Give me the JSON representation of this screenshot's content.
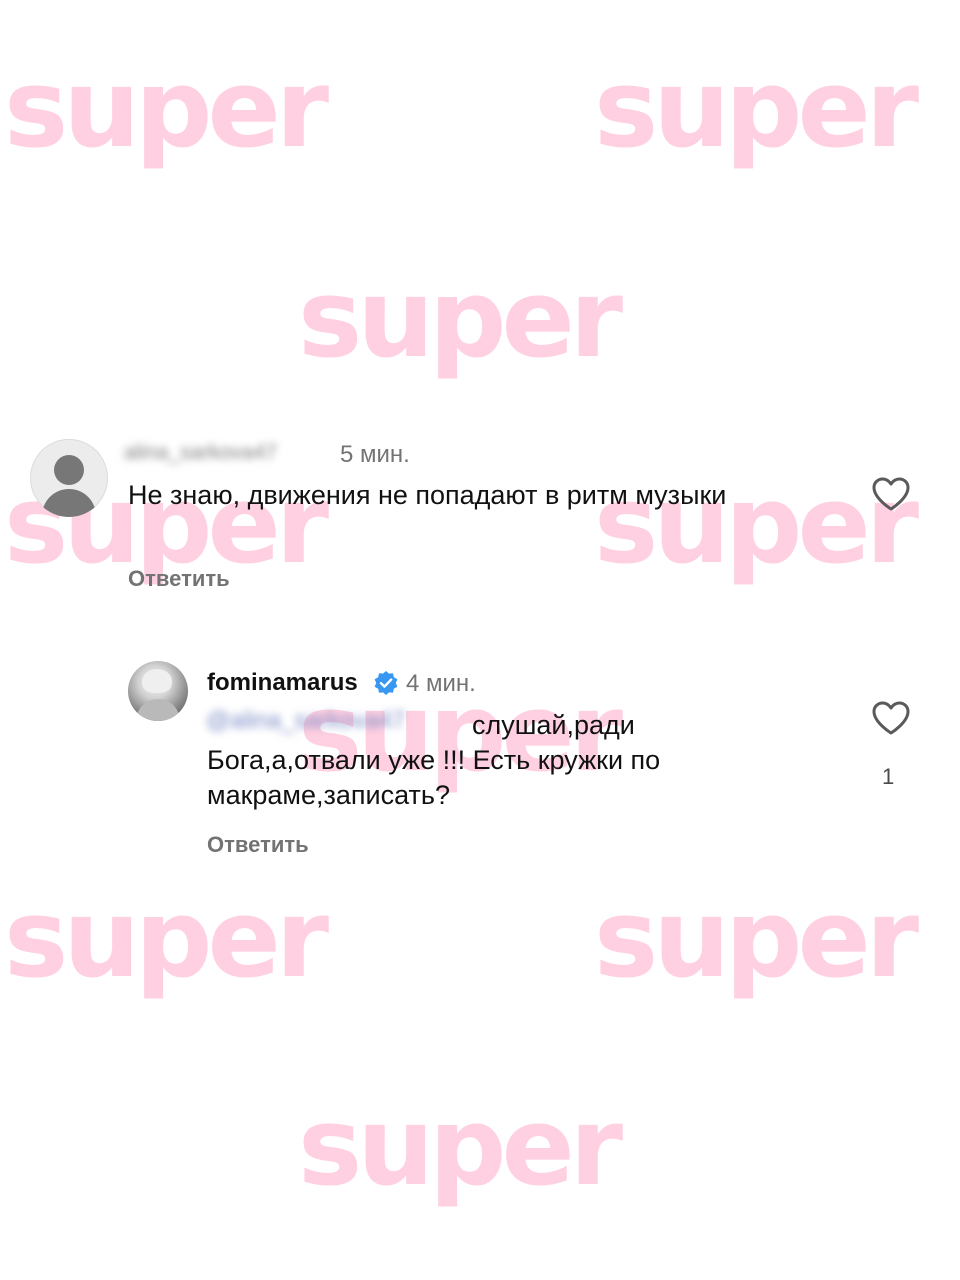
{
  "watermark": {
    "text": "super",
    "color": "#ffc8dc"
  },
  "comments": [
    {
      "username_blurred": "alina_sarkova47",
      "time": "5 мин.",
      "text": "Не знаю, движения не попадают в ритм музыки",
      "reply_label": "Ответить",
      "avatar_icon": "default-avatar-icon",
      "like_icon": "heart-outline-icon"
    },
    {
      "username": "fominamarus",
      "verified_icon": "verified-badge-icon",
      "time": "4 мин.",
      "mention_blurred": "@alina_sarkova47",
      "text_line1": "слушай,ради",
      "text_rest": "Бога,а,отвали уже !!! Есть кружки по макраме,записать?",
      "reply_label": "Ответить",
      "avatar_icon": "profile-photo-avatar",
      "like_icon": "heart-outline-icon",
      "like_count": "1"
    }
  ],
  "colors": {
    "secondary_text": "#737373",
    "verified_blue": "#3897f0",
    "mention_blue": "#7c8bc6"
  }
}
